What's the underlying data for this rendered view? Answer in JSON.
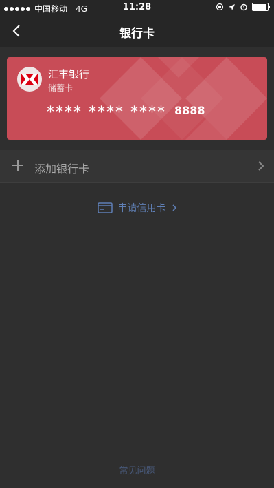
{
  "status_bar": {
    "carrier": "中国移动",
    "network": "4G",
    "time": "11:28"
  },
  "nav": {
    "title": "银行卡"
  },
  "card": {
    "bank_name": "汇丰银行",
    "card_type": "储蓄卡",
    "masked_number": "**** **** ****",
    "last_digits": "8888",
    "color": "#c84c57"
  },
  "add_card": {
    "label": "添加银行卡"
  },
  "apply_credit": {
    "label": "申请信用卡",
    "color": "#5f7fb5"
  },
  "footer": {
    "faq_label": "常见问题"
  }
}
